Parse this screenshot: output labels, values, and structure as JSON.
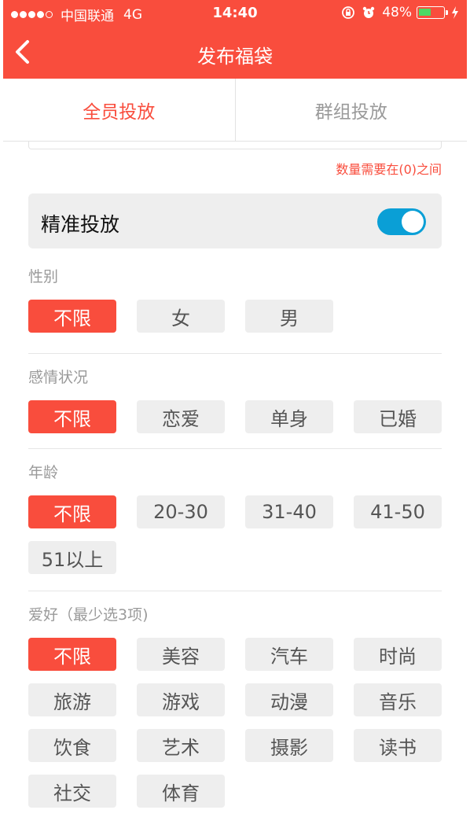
{
  "status_bar": {
    "carrier": "中国联通",
    "network": "4G",
    "time": "14:40",
    "battery": "48%",
    "battery_level": 0.48,
    "signal_bars": 4
  },
  "nav": {
    "title": "发布福袋"
  },
  "tabs": [
    {
      "label": "全员投放",
      "active": true
    },
    {
      "label": "群组投放",
      "active": false
    }
  ],
  "quantity_hint": "数量需要在(0)之间",
  "precise": {
    "label": "精准投放",
    "enabled": true
  },
  "sections": {
    "gender": {
      "title": "性别",
      "options": [
        {
          "label": "不限",
          "selected": true
        },
        {
          "label": "女",
          "selected": false
        },
        {
          "label": "男",
          "selected": false
        }
      ]
    },
    "relationship": {
      "title": "感情状况",
      "options": [
        {
          "label": "不限",
          "selected": true
        },
        {
          "label": "恋爱",
          "selected": false
        },
        {
          "label": "单身",
          "selected": false
        },
        {
          "label": "已婚",
          "selected": false
        }
      ]
    },
    "age": {
      "title": "年龄",
      "options": [
        {
          "label": "不限",
          "selected": true
        },
        {
          "label": "20-30",
          "selected": false
        },
        {
          "label": "31-40",
          "selected": false
        },
        {
          "label": "41-50",
          "selected": false
        },
        {
          "label": "51以上",
          "selected": false
        }
      ]
    },
    "hobbies": {
      "title": "爱好（最少选3项)",
      "options": [
        {
          "label": "不限",
          "selected": true
        },
        {
          "label": "美容",
          "selected": false
        },
        {
          "label": "汽车",
          "selected": false
        },
        {
          "label": "时尚",
          "selected": false
        },
        {
          "label": "旅游",
          "selected": false
        },
        {
          "label": "游戏",
          "selected": false
        },
        {
          "label": "动漫",
          "selected": false
        },
        {
          "label": "音乐",
          "selected": false
        },
        {
          "label": "饮食",
          "selected": false
        },
        {
          "label": "艺术",
          "selected": false
        },
        {
          "label": "摄影",
          "selected": false
        },
        {
          "label": "读书",
          "selected": false
        },
        {
          "label": "社交",
          "selected": false
        },
        {
          "label": "体育",
          "selected": false
        }
      ]
    }
  },
  "colors": {
    "accent": "#f94d3d",
    "toggle_on": "#0a9fd6",
    "chip_bg": "#eeeeee"
  }
}
